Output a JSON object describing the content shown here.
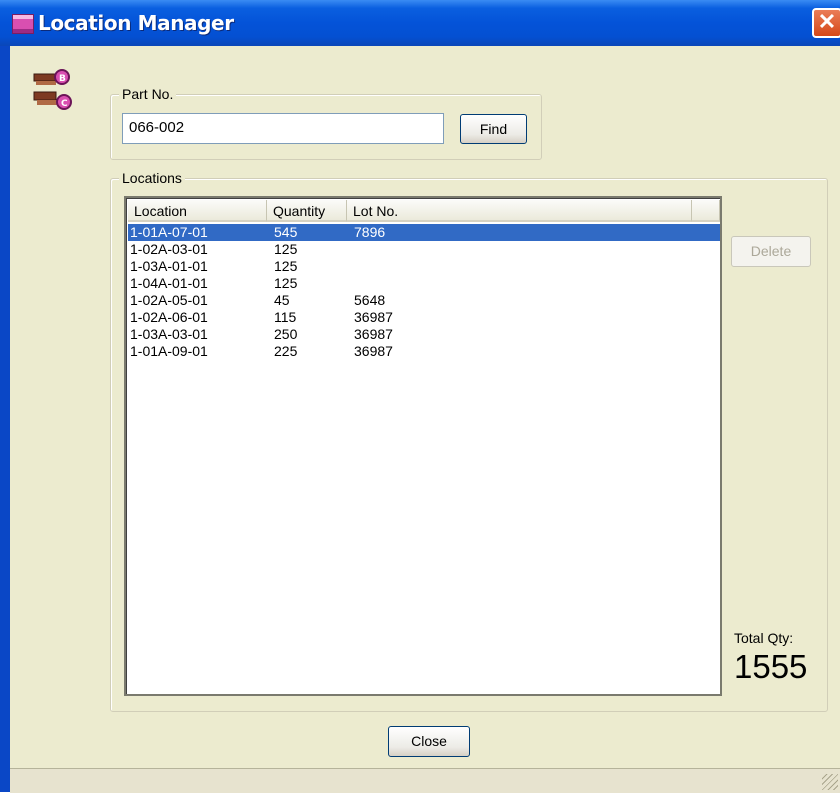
{
  "window": {
    "title": "Location Manager",
    "close_glyph": "✕"
  },
  "part_group": {
    "label": "Part No.",
    "part_no_value": "066-002",
    "find_label": "Find"
  },
  "locations_group": {
    "label": "Locations",
    "columns": [
      "Location",
      "Quantity",
      "Lot No."
    ],
    "rows": [
      {
        "location": "1-01A-07-01",
        "quantity": "545",
        "lot": "7896",
        "selected": true
      },
      {
        "location": "1-02A-03-01",
        "quantity": "125",
        "lot": ""
      },
      {
        "location": "1-03A-01-01",
        "quantity": "125",
        "lot": ""
      },
      {
        "location": "1-04A-01-01",
        "quantity": "125",
        "lot": ""
      },
      {
        "location": "1-02A-05-01",
        "quantity": "45",
        "lot": "5648"
      },
      {
        "location": "1-02A-06-01",
        "quantity": "115",
        "lot": "36987"
      },
      {
        "location": "1-03A-03-01",
        "quantity": "250",
        "lot": "36987"
      },
      {
        "location": "1-01A-09-01",
        "quantity": "225",
        "lot": "36987"
      }
    ],
    "delete_label": "Delete",
    "total_label": "Total Qty:",
    "total_value": "1555"
  },
  "footer": {
    "close_label": "Close"
  },
  "colors": {
    "titlebar": "#0453d8",
    "selection": "#316ac5",
    "window_bg": "#ecebcf"
  }
}
